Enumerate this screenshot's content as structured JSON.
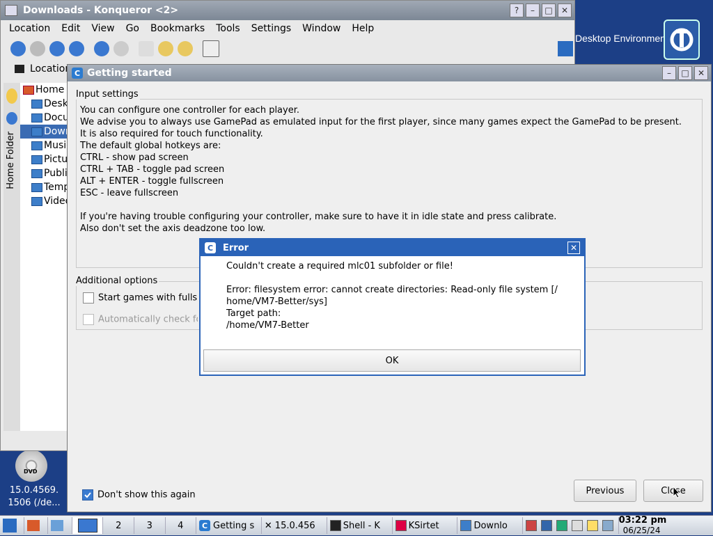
{
  "desktop": {
    "brand_text": "Desktop Environment",
    "dvd_label": "DVD",
    "dvd_caption_line1": "15.0.4569.",
    "dvd_caption_line2": "1506 (/de..."
  },
  "konqueror": {
    "title": "Downloads - Konqueror <2>",
    "title_buttons": [
      "?",
      "–",
      "□",
      "✕"
    ],
    "menu": [
      "Location",
      "Edit",
      "View",
      "Go",
      "Bookmarks",
      "Tools",
      "Settings",
      "Window",
      "Help"
    ],
    "location_label": "Location",
    "sidebar_tab": "Home Folder",
    "tree": [
      {
        "label": "Home F",
        "selected": false
      },
      {
        "label": "Desk",
        "selected": false
      },
      {
        "label": "Docu",
        "selected": false
      },
      {
        "label": "Down",
        "selected": true
      },
      {
        "label": "Music",
        "selected": false
      },
      {
        "label": "Pictu",
        "selected": false
      },
      {
        "label": "Publi",
        "selected": false
      },
      {
        "label": "Temp",
        "selected": false
      },
      {
        "label": "Video",
        "selected": false
      }
    ]
  },
  "getting_started": {
    "title": "Getting started",
    "input_settings_label": "Input settings",
    "lines": [
      "You can configure one controller for each player.",
      "We advise you to always use GamePad as emulated input for the first player, since many games expect the GamePad to be present.",
      "It is also required for touch functionality.",
      "The default global hotkeys are:",
      "CTRL - show pad screen",
      "CTRL + TAB - toggle pad screen",
      "ALT + ENTER - toggle fullscreen",
      "ESC - leave fullscreen",
      "",
      "If you're having trouble configuring your controller, make sure to have it in idle state and press calibrate.",
      "Also don't set the axis deadzone too low."
    ],
    "additional_options_label": "Additional options",
    "option_fullscreen": "Start games with fullscreen",
    "option_autocheck": "Automatically check for updates",
    "dont_show_label": "Don't show this again",
    "previous_button": "Previous",
    "close_button": "Close"
  },
  "error_dialog": {
    "title": "Error",
    "message_line1": "Couldn't create a required mlc01 subfolder or file!",
    "message_line2": "Error: filesystem error: cannot create directories: Read-only file system [/",
    "message_line3": "home/VM7-Better/sys]",
    "message_line4": "Target path:",
    "message_line5": "/home/VM7-Better",
    "ok_button": "OK"
  },
  "taskbar": {
    "pagers": [
      "2",
      "3",
      "4"
    ],
    "tasks": [
      "Getting s",
      "15.0.456",
      "Shell - K",
      "KSirtet",
      "Downlo"
    ],
    "time": "03:22 pm",
    "date": "06/25/24"
  }
}
